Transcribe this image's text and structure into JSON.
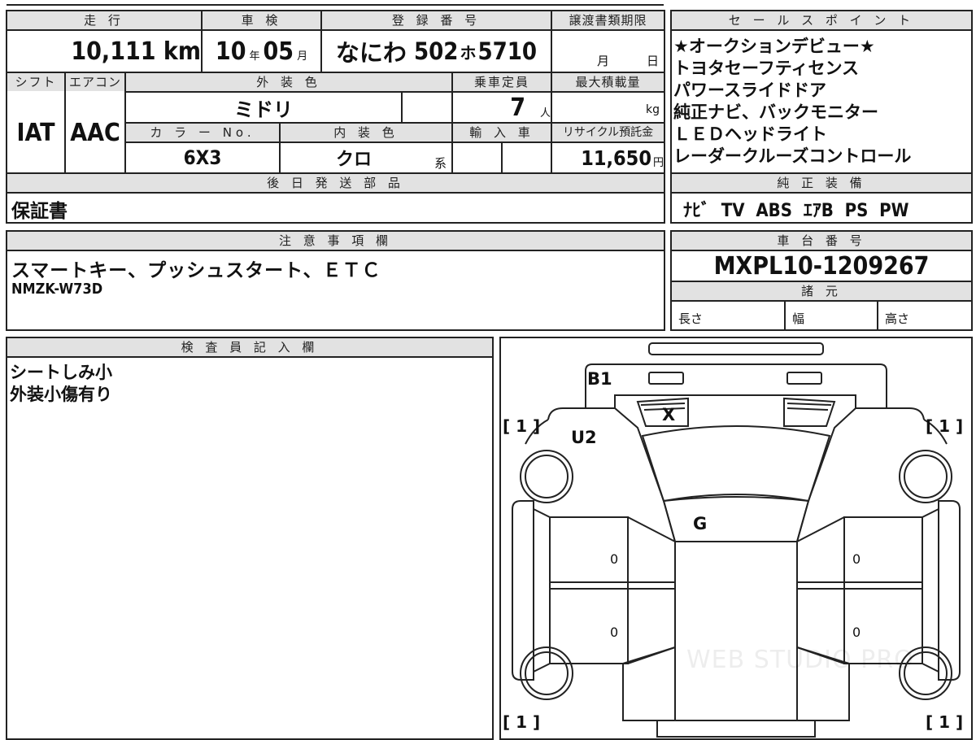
{
  "top": {
    "mileage_label": "走 行",
    "mileage_value": "10,111",
    "mileage_unit": "km",
    "shaken_label": "車 検",
    "shaken_year": "10",
    "shaken_year_unit": "年",
    "shaken_month": "05",
    "shaken_month_unit": "月",
    "reg_label": "登 録 番 号",
    "reg_area": "なにわ",
    "reg_class": "502",
    "reg_kana": "ホ",
    "reg_number": "5710",
    "transfer_label": "譲渡書類期限",
    "transfer_month": "月",
    "transfer_day": "日"
  },
  "row2": {
    "shift_label": "シフト",
    "shift_value": "IAT",
    "ac_label": "エアコン",
    "ac_value": "AAC",
    "exterior_label": "外 装 色",
    "exterior_value": "ミドリ",
    "color_no_label": "カ ラ ー No.",
    "color_no_value": "6X3",
    "interior_label": "内 装 色",
    "interior_value": "クロ",
    "interior_unit": "系",
    "capacity_label": "乗車定員",
    "capacity_value": "7",
    "capacity_unit": "人",
    "import_label": "輸 入 車",
    "load_label": "最大積載量",
    "load_unit": "kg",
    "recycle_label": "リサイクル預託金",
    "recycle_value": "11,650",
    "recycle_unit": "円"
  },
  "later_parts": {
    "label": "後 日 発 送 部 品",
    "value": "保証書"
  },
  "sales_points": {
    "label": "セ ー ル ス ポ イ ン ト",
    "items": [
      "★オークションデビュー★",
      "トヨタセーフティセンス",
      "パワースライドドア",
      "純正ナビ、バックモニター",
      "ＬＥＤヘッドライト",
      "レーダークルーズコントロール"
    ]
  },
  "equipment": {
    "label": "純 正 装 備",
    "value": "ﾅﾋﾞ  TV  ABS  ｴｱB  PS  PW"
  },
  "notes": {
    "label": "注 意 事 項 欄",
    "line1": "スマートキー、プッシュスタート、ＥＴＣ",
    "line2": "NMZK-W73D"
  },
  "chassis": {
    "label": "車 台 番 号",
    "value": "MXPL10-1209267"
  },
  "specs": {
    "label": "諸 元",
    "length": "長さ",
    "width": "幅",
    "height": "高さ"
  },
  "inspector": {
    "label": "検 査 員 記 入 欄",
    "line1": "シートしみ小",
    "line2": "外装小傷有り"
  },
  "diagram": {
    "bracket_tl": "[ 1 ]",
    "bracket_tr": "[ 1 ]",
    "bracket_bl": "[ 1 ]",
    "bracket_br": "[ 1 ]",
    "mark_b1": "B1",
    "mark_u2": "U2",
    "mark_x": "X",
    "mark_g": "G",
    "left_front_door": "0",
    "left_rear_door": "0",
    "right_front_door": "0",
    "right_rear_door": "0",
    "watermark": "WEB STUDIO PRO"
  }
}
